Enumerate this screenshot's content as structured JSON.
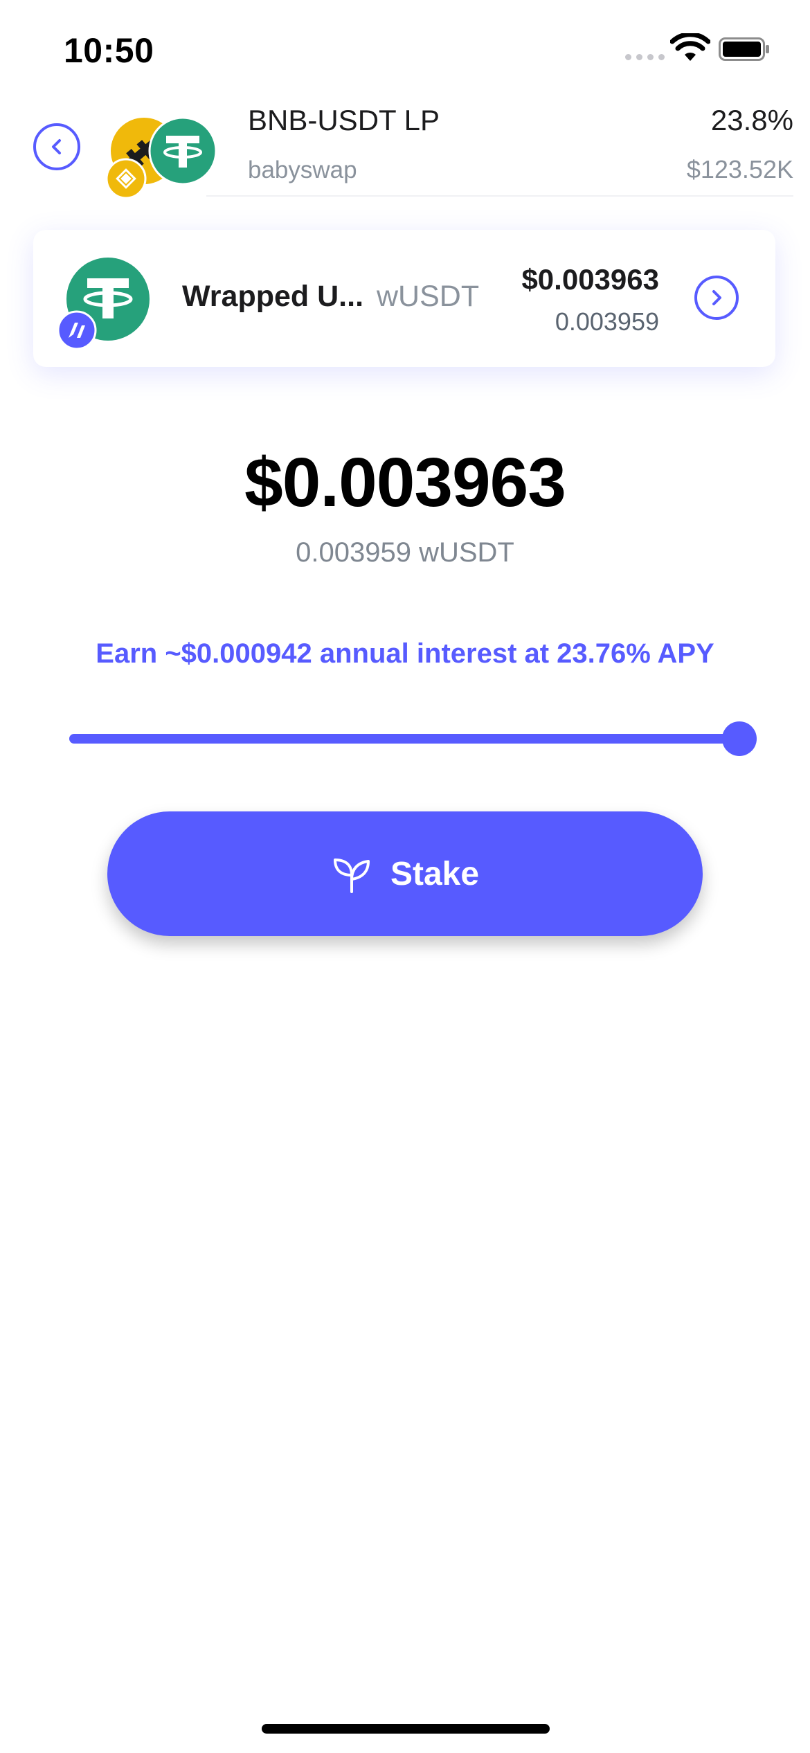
{
  "status_bar": {
    "time": "10:50",
    "icons": [
      "cellular-signal-icon",
      "wifi-icon",
      "battery-icon"
    ]
  },
  "pool": {
    "title": "BNB-USDT LP",
    "platform": "babyswap",
    "apy": "23.8%",
    "tvl": "$123.52K",
    "icons": [
      "bnb-token-icon",
      "usdt-token-icon",
      "babyswap-icon"
    ]
  },
  "token": {
    "name": "Wrapped U...",
    "symbol": "wUSDT",
    "usd_value": "$0.003963",
    "amount": "0.003959",
    "icons": [
      "tether-icon",
      "network-badge-icon"
    ]
  },
  "stake": {
    "amount_usd": "$0.003963",
    "amount_token": "0.003959 wUSDT",
    "earn_text": "Earn ~$0.000942 annual interest at 23.76% APY",
    "slider_value_percent": 100,
    "button_label": "Stake",
    "button_icon": "sprout-icon"
  },
  "colors": {
    "accent": "#575bff",
    "tether_green": "#26a17b",
    "bnb_yellow": "#f0b90b",
    "muted_text": "#8a929c"
  }
}
